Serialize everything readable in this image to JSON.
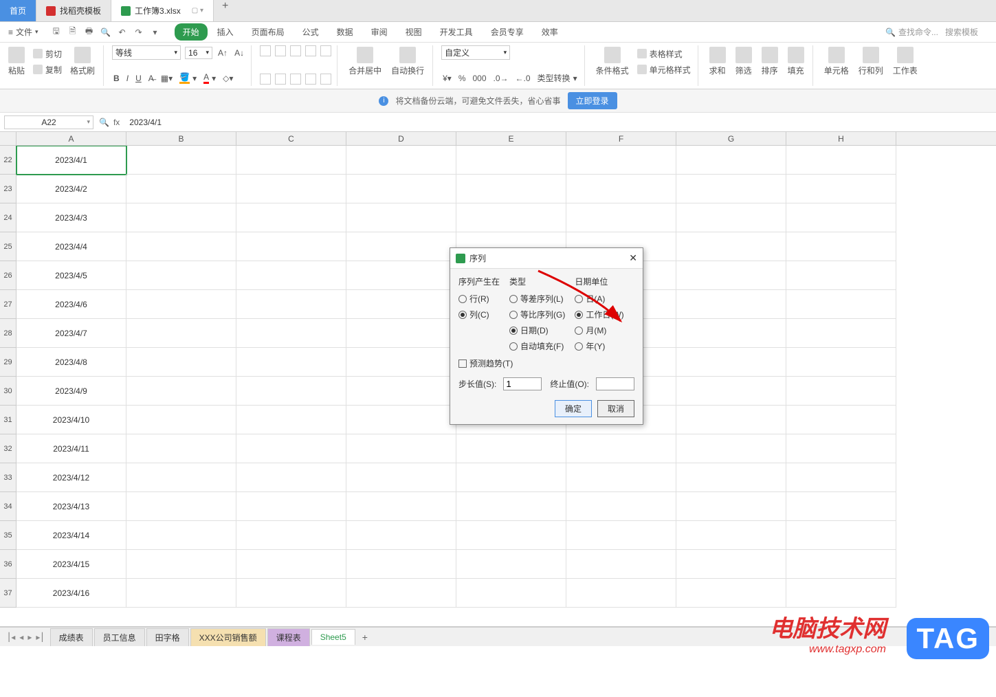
{
  "app_tabs": {
    "home": "首页",
    "template": "找稻壳模板",
    "current": "工作簿3.xlsx",
    "plus": "+"
  },
  "menu": {
    "file": "文件",
    "ribbon_tabs": [
      "开始",
      "插入",
      "页面布局",
      "公式",
      "数据",
      "审阅",
      "视图",
      "开发工具",
      "会员专享",
      "效率"
    ],
    "search_cmd": "查找命令...",
    "search_tpl": "搜索模板"
  },
  "ribbon": {
    "paste": "粘贴",
    "cut": "剪切",
    "copy": "复制",
    "format_painter": "格式刷",
    "font_name": "等线",
    "font_size": "16",
    "merge": "合并居中",
    "wrap": "自动换行",
    "number_format": "自定义",
    "type_convert": "类型转换",
    "cond_format": "条件格式",
    "table_style": "表格样式",
    "cell_style": "单元格样式",
    "sum": "求和",
    "filter": "筛选",
    "sort": "排序",
    "fill": "填充",
    "cell": "单元格",
    "row_col": "行和列",
    "worksheet": "工作表"
  },
  "banner": {
    "text": "将文档备份云端，可避免文件丢失，省心省事",
    "login": "立即登录"
  },
  "formula": {
    "name": "A22",
    "fx": "fx",
    "value": "2023/4/1"
  },
  "columns": [
    "A",
    "B",
    "C",
    "D",
    "E",
    "F",
    "G",
    "H"
  ],
  "rows": [
    {
      "n": "22",
      "a": "2023/4/1"
    },
    {
      "n": "23",
      "a": "2023/4/2"
    },
    {
      "n": "24",
      "a": "2023/4/3"
    },
    {
      "n": "25",
      "a": "2023/4/4"
    },
    {
      "n": "26",
      "a": "2023/4/5"
    },
    {
      "n": "27",
      "a": "2023/4/6"
    },
    {
      "n": "28",
      "a": "2023/4/7"
    },
    {
      "n": "29",
      "a": "2023/4/8"
    },
    {
      "n": "30",
      "a": "2023/4/9"
    },
    {
      "n": "31",
      "a": "2023/4/10"
    },
    {
      "n": "32",
      "a": "2023/4/11"
    },
    {
      "n": "33",
      "a": "2023/4/12"
    },
    {
      "n": "34",
      "a": "2023/4/13"
    },
    {
      "n": "35",
      "a": "2023/4/14"
    },
    {
      "n": "36",
      "a": "2023/4/15"
    },
    {
      "n": "37",
      "a": "2023/4/16"
    }
  ],
  "dialog": {
    "title": "序列",
    "section1": "序列产生在",
    "row": "行(R)",
    "col": "列(C)",
    "section2": "类型",
    "arith": "等差序列(L)",
    "geom": "等比序列(G)",
    "date": "日期(D)",
    "autofill": "自动填充(F)",
    "section3": "日期单位",
    "day": "日(A)",
    "workday": "工作日(W)",
    "month": "月(M)",
    "year": "年(Y)",
    "predict": "预测趋势(T)",
    "step_label": "步长值(S):",
    "step_value": "1",
    "stop_label": "终止值(O):",
    "stop_value": "",
    "ok": "确定",
    "cancel": "取消"
  },
  "sheets": [
    "成绩表",
    "员工信息",
    "田字格",
    "XXX公司销售额",
    "课程表",
    "Sheet5"
  ],
  "watermark": {
    "t1": "电脑技术网",
    "t2": "www.tagxp.com",
    "badge": "TAG"
  }
}
